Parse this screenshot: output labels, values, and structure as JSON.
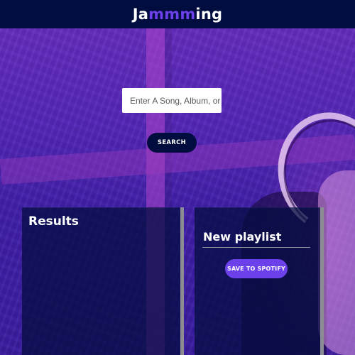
{
  "app": {
    "title_prefix": "Ja",
    "title_accent": "mmm",
    "title_suffix": "ing",
    "accent_color": "#6c41ec",
    "header_color": "#010c3f"
  },
  "search": {
    "placeholder": "Enter A Song, Album, or Artist",
    "value": "",
    "button_label": "SEARCH"
  },
  "results": {
    "title": "Results",
    "tracks": []
  },
  "playlist": {
    "name_value": "New playlist",
    "save_label": "SAVE TO SPOTIFY",
    "tracks": []
  }
}
